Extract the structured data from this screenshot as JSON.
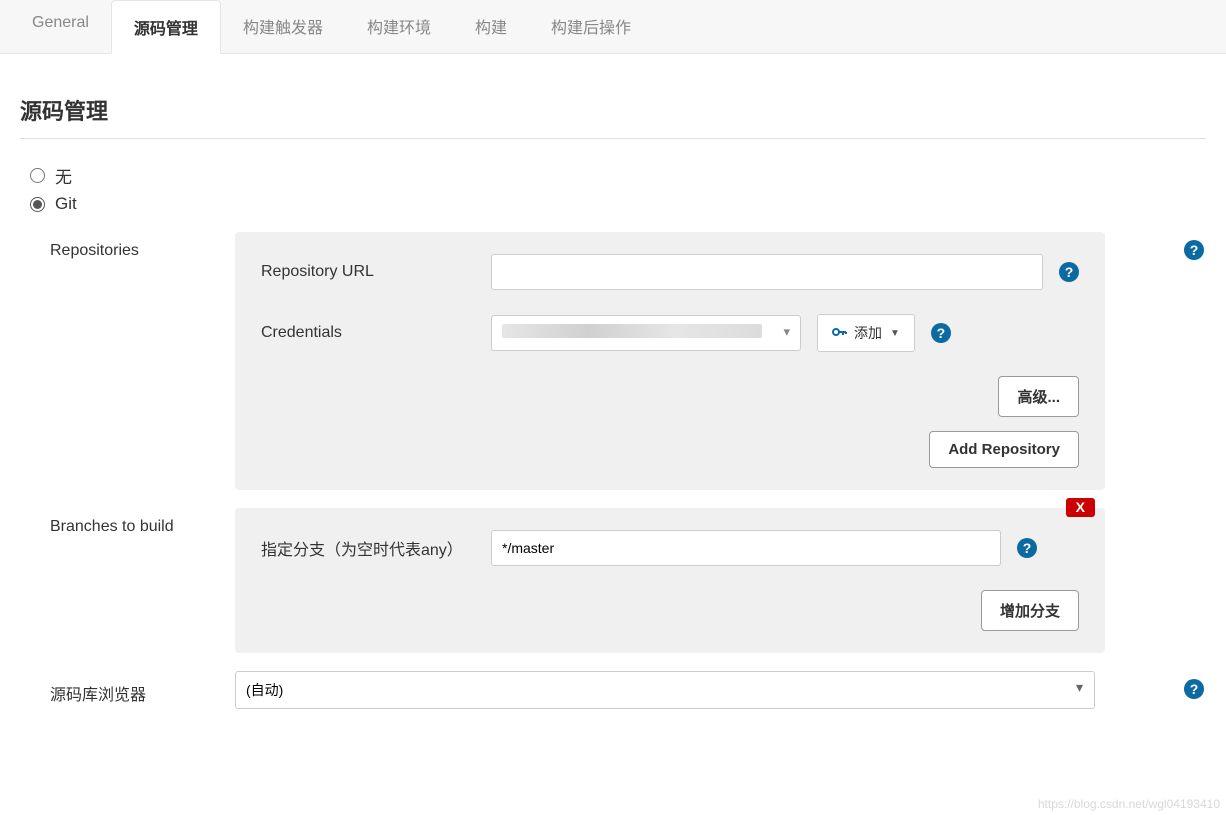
{
  "tabs": [
    {
      "label": "General"
    },
    {
      "label": "源码管理",
      "active": true
    },
    {
      "label": "构建触发器"
    },
    {
      "label": "构建环境"
    },
    {
      "label": "构建"
    },
    {
      "label": "构建后操作"
    }
  ],
  "section_title": "源码管理",
  "scm": {
    "none_label": "无",
    "git_label": "Git",
    "repositories_label": "Repositories",
    "repo_url_label": "Repository URL",
    "repo_url_value": "",
    "credentials_label": "Credentials",
    "credentials_display": "",
    "add_button_label": "添加",
    "advanced_button_label": "高级...",
    "add_repository_button_label": "Add Repository",
    "branches_label": "Branches to build",
    "branch_spec_label": "指定分支（为空时代表any）",
    "branch_spec_value": "*/master",
    "delete_label": "X",
    "add_branch_button_label": "增加分支",
    "repo_browser_label": "源码库浏览器",
    "repo_browser_value": "(自动)"
  },
  "watermark": "https://blog.csdn.net/wgl04193410"
}
